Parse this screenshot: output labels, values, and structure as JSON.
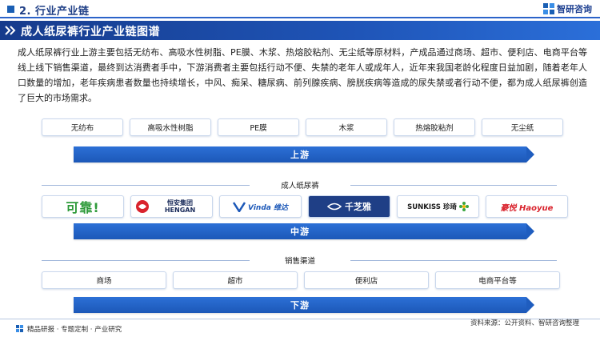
{
  "header": {
    "title": "2. 行业产业链",
    "brand": "智研咨询"
  },
  "section": {
    "title": "成人纸尿裤行业产业链图谱"
  },
  "intro": {
    "text": "成人纸尿裤行业上游主要包括无纺布、高吸水性树脂、PE膜、木浆、热熔胶粘剂、无尘纸等原材料，产成品通过商场、超市、便利店、电商平台等线上线下销售渠道，最终到达消费者手中，下游消费者主要包括行动不便、失禁的老年人或成年人，近年来我国老龄化程度日益加剧，随着老年人口数量的增加，老年疾病患者数量也持续增长，中风、痴呆、糖尿病、前列腺疾病、膀胱疾病等造成的尿失禁或者行动不便，都为成人纸尿裤创造了巨大的市场需求。"
  },
  "upstream": {
    "materials": [
      "无纺布",
      "高吸水性树脂",
      "PE膜",
      "木浆",
      "热熔胶粘剂",
      "无尘纸"
    ],
    "label": "上游"
  },
  "midstream": {
    "group_label": "成人纸尿裤",
    "brands": [
      "可靠!",
      "恒安集团 HENGAN",
      "Vinda 维达",
      "千芝雅",
      "SUNKISS 珍琦",
      "豪悦 Haoyue"
    ],
    "label": "中游"
  },
  "channels": {
    "group_label": "销售渠道",
    "items": [
      "商场",
      "超市",
      "便利店",
      "电商平台等"
    ]
  },
  "downstream": {
    "label": "下游"
  },
  "footer": {
    "left": "精品研报 · 专题定制 · 产业研究",
    "source": "资料来源：公开资料、智研咨询整理"
  },
  "colors": {
    "primary": "#1f55b8",
    "accent": "#2c70d6",
    "header_text": "#1f3f86"
  }
}
